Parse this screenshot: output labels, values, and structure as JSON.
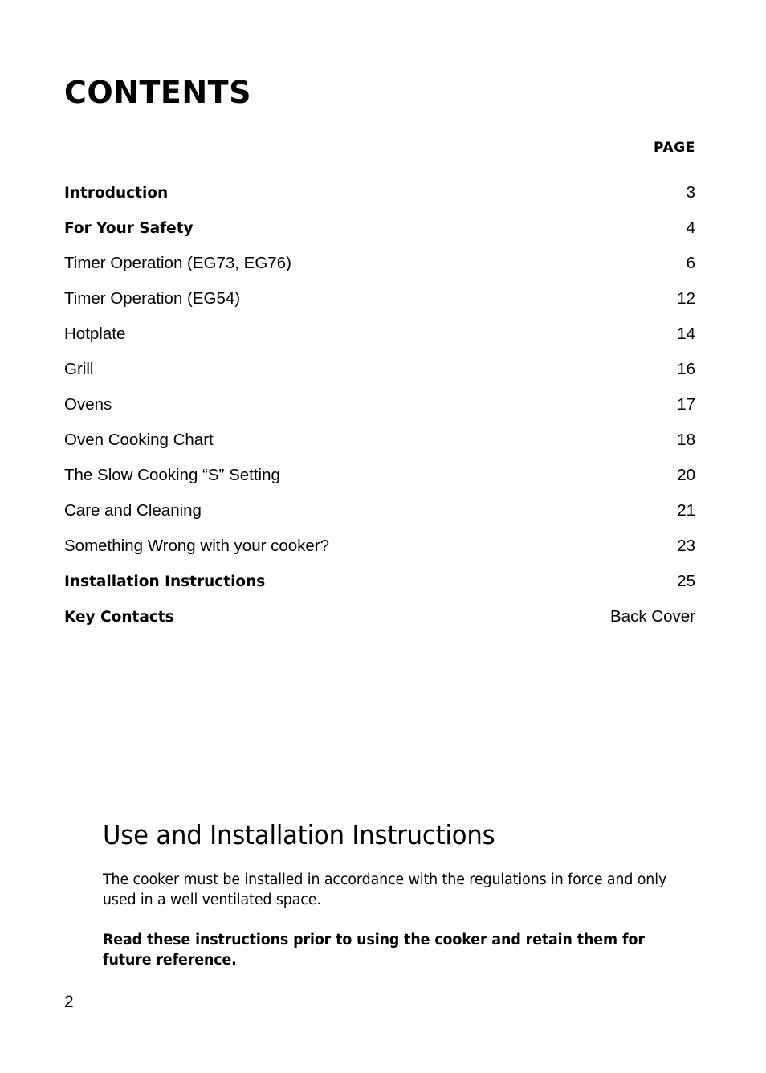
{
  "document": {
    "contents_heading": "CONTENTS",
    "page_column_header": "PAGE",
    "folio": "2"
  },
  "toc": {
    "entries": [
      {
        "label": "Introduction",
        "page": "3",
        "bold": true
      },
      {
        "label": "For Your Safety",
        "page": "4",
        "bold": true
      },
      {
        "label": "Timer Operation (EG73, EG76)",
        "page": "6",
        "bold": false
      },
      {
        "label": "Timer Operation (EG54)",
        "page": "12",
        "bold": false
      },
      {
        "label": "Hotplate",
        "page": "14",
        "bold": false
      },
      {
        "label": "Grill",
        "page": "16",
        "bold": false
      },
      {
        "label": "Ovens",
        "page": "17",
        "bold": false
      },
      {
        "label": "Oven Cooking Chart",
        "page": "18",
        "bold": false
      },
      {
        "label": "The Slow Cooking “S” Setting",
        "page": "20",
        "bold": false
      },
      {
        "label": "Care and Cleaning",
        "page": "21",
        "bold": false
      },
      {
        "label": "Something Wrong with your cooker?",
        "page": "23",
        "bold": false
      },
      {
        "label": "Installation Instructions",
        "page": "25",
        "bold": true
      },
      {
        "label": "Key Contacts",
        "page": "Back Cover",
        "bold": true
      }
    ]
  },
  "lower_section": {
    "title": "Use and Installation Instructions",
    "paragraph": "The cooker must be installed in accordance with the regulations in force and only used in a well ventilated space.",
    "notice": "Read these instructions prior to using the cooker and retain them for future reference."
  }
}
